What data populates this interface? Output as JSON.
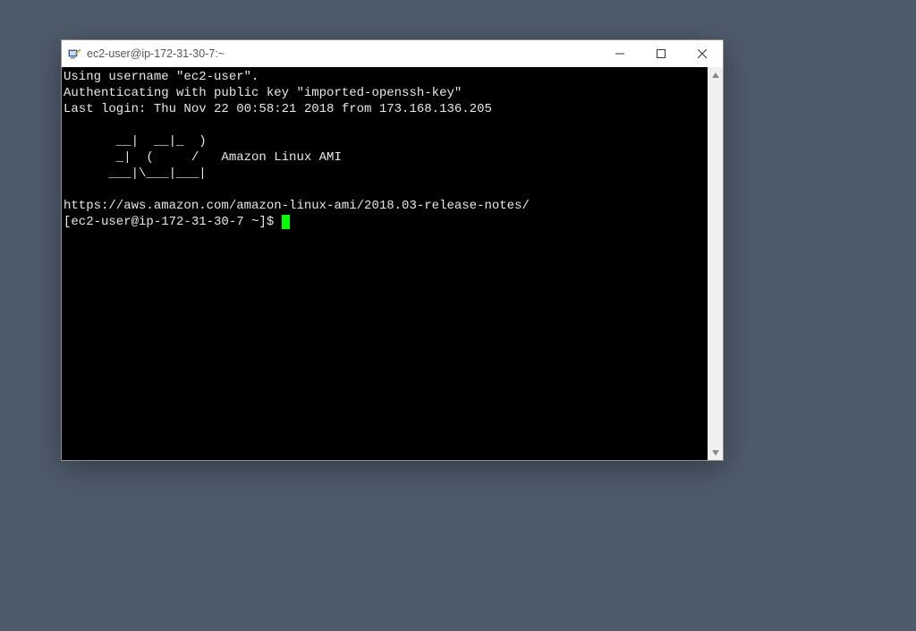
{
  "window": {
    "title": "ec2-user@ip-172-31-30-7:~"
  },
  "terminal": {
    "line_username": "Using username \"ec2-user\".",
    "line_auth": "Authenticating with public key \"imported-openssh-key\"",
    "line_lastlogin": "Last login: Thu Nov 22 00:58:21 2018 from 173.168.136.205",
    "banner1": "       __|  __|_  )",
    "banner2": "       _|  (     /   Amazon Linux AMI",
    "banner3": "      ___|\\___|___|",
    "release_url": "https://aws.amazon.com/amazon-linux-ami/2018.03-release-notes/",
    "prompt": "[ec2-user@ip-172-31-30-7 ~]$ "
  }
}
